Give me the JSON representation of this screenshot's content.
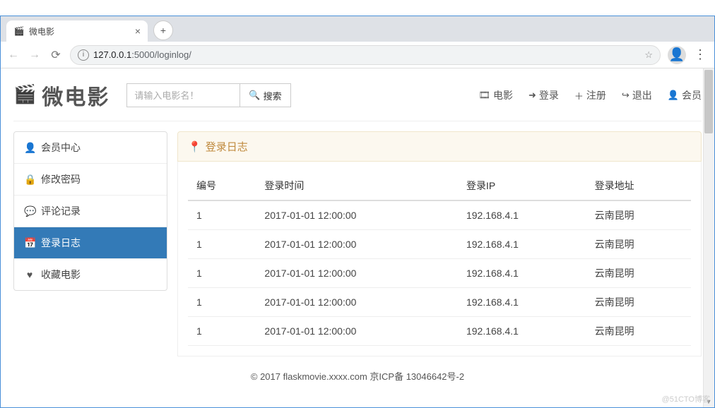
{
  "browser": {
    "tab_title": "微电影",
    "url_host": "127.0.0.1",
    "url_port": ":5000",
    "url_path": "/loginlog/",
    "new_tab_label": "+",
    "close_tab_label": "×"
  },
  "win_controls": {
    "min": "─",
    "max": "☐",
    "close": "✕"
  },
  "header": {
    "logo_text": "微电影",
    "search_placeholder": "请输入电影名！",
    "search_button": "搜索"
  },
  "nav": {
    "movie": "电影",
    "login": "登录",
    "register": "注册",
    "logout": "退出",
    "member": "会员"
  },
  "sidebar": {
    "items": [
      {
        "icon": "user",
        "label": "会员中心"
      },
      {
        "icon": "lock",
        "label": "修改密码"
      },
      {
        "icon": "comment",
        "label": "评论记录"
      },
      {
        "icon": "calendar",
        "label": "登录日志"
      },
      {
        "icon": "heart",
        "label": "收藏电影"
      }
    ],
    "active_index": 3
  },
  "panel": {
    "title": "登录日志",
    "columns": [
      "编号",
      "登录时间",
      "登录IP",
      "登录地址"
    ],
    "rows": [
      {
        "id": "1",
        "time": "2017-01-01 12:00:00",
        "ip": "192.168.4.1",
        "loc": "云南昆明"
      },
      {
        "id": "1",
        "time": "2017-01-01 12:00:00",
        "ip": "192.168.4.1",
        "loc": "云南昆明"
      },
      {
        "id": "1",
        "time": "2017-01-01 12:00:00",
        "ip": "192.168.4.1",
        "loc": "云南昆明"
      },
      {
        "id": "1",
        "time": "2017-01-01 12:00:00",
        "ip": "192.168.4.1",
        "loc": "云南昆明"
      },
      {
        "id": "1",
        "time": "2017-01-01 12:00:00",
        "ip": "192.168.4.1",
        "loc": "云南昆明"
      }
    ]
  },
  "footer": {
    "text": "© 2017 flaskmovie.xxxx.com 京ICP备 13046642号-2"
  },
  "watermark": "@51CTO博客"
}
